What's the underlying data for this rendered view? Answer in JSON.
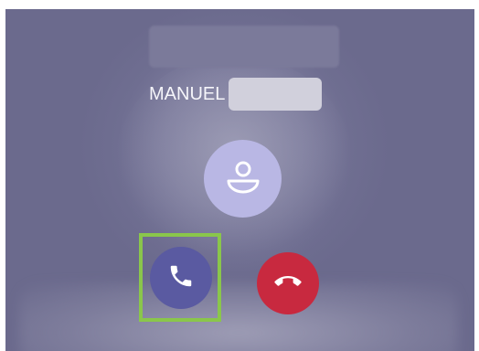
{
  "caller": {
    "name": "MANUEL"
  },
  "icons": {
    "avatar": "person-icon",
    "accept": "phone-icon",
    "decline": "phone-hangup-icon"
  },
  "colors": {
    "background": "#6f6e91",
    "avatar": "#b9b7e4",
    "accept": "#5a5aa1",
    "decline": "#c8293f",
    "highlight": "#8ac64b"
  }
}
